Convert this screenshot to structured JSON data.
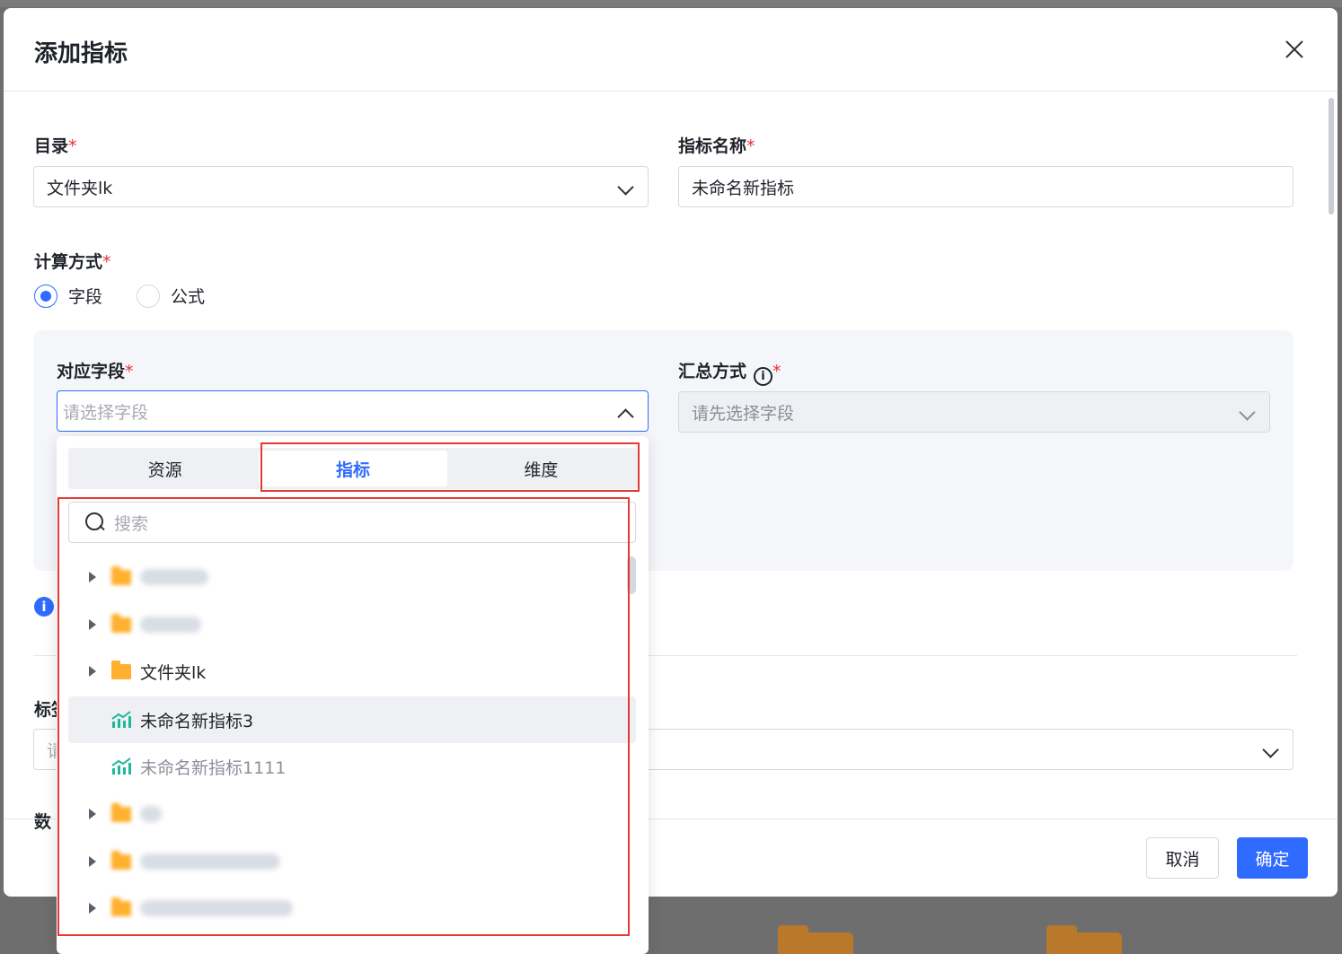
{
  "modal": {
    "title": "添加指标",
    "catalog": {
      "label": "目录",
      "required": "*",
      "value": "文件夹lk"
    },
    "metric_name": {
      "label": "指标名称",
      "required": "*",
      "value": "未命名新指标"
    },
    "calc_method": {
      "label": "计算方式",
      "required": "*",
      "options": [
        {
          "label": "字段",
          "selected": true
        },
        {
          "label": "公式",
          "selected": false
        }
      ]
    },
    "field": {
      "label": "对应字段",
      "required": "*",
      "placeholder": "请选择字段"
    },
    "aggregation": {
      "label": "汇总方式",
      "required": "*",
      "info": "i",
      "placeholder": "请先选择字段"
    },
    "info_icon": "i",
    "footer": {
      "cancel": "取消",
      "ok": "确定"
    }
  },
  "dropdown": {
    "tabs": [
      {
        "label": "资源",
        "active": false
      },
      {
        "label": "指标",
        "active": true
      },
      {
        "label": "维度",
        "active": false
      }
    ],
    "search_placeholder": "搜索",
    "items": [
      {
        "type": "folder",
        "label": "",
        "blurred": true,
        "expandable": true
      },
      {
        "type": "folder",
        "label": "",
        "blurred": true,
        "expandable": true
      },
      {
        "type": "folder",
        "label": "文件夹lk",
        "blurred": false,
        "expandable": true
      },
      {
        "type": "metric",
        "label": "未命名新指标3",
        "highlighted": true
      },
      {
        "type": "metric",
        "label": "未命名新指标1111",
        "disabled": true
      },
      {
        "type": "folder",
        "label": "",
        "blurred": true,
        "expandable": true
      },
      {
        "type": "folder",
        "label": "",
        "blurred": true,
        "expandable": true
      },
      {
        "type": "folder",
        "label": "",
        "blurred": true,
        "expandable": true
      }
    ]
  },
  "colors": {
    "primary": "#2f6bff",
    "required": "#e5323a",
    "highlight_box": "#e53935",
    "folder": "#ffb02e",
    "metric_icon": "#1db89a"
  }
}
